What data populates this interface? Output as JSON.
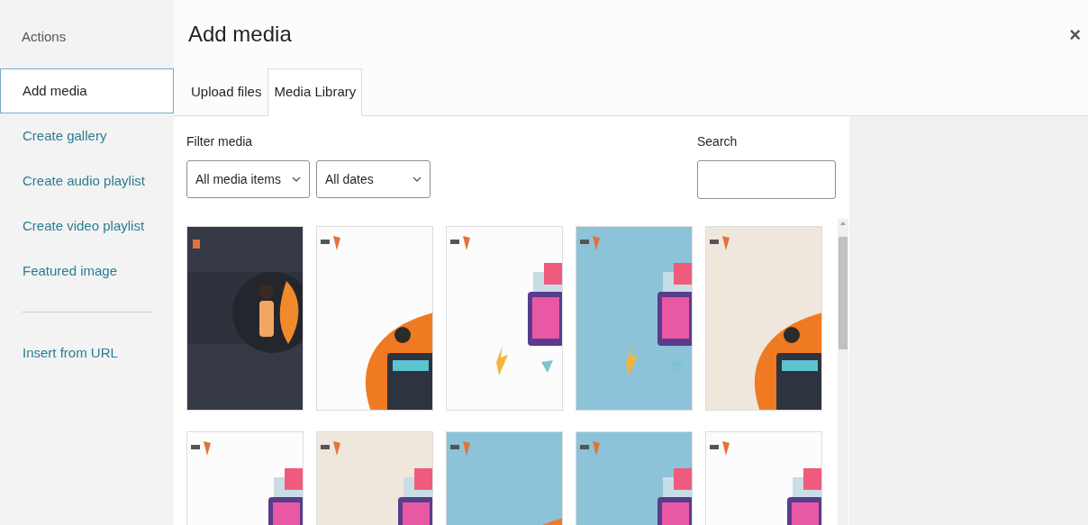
{
  "sidebar": {
    "heading": "Actions",
    "items": [
      {
        "label": "Add media",
        "selected": true
      },
      {
        "label": "Create gallery",
        "selected": false
      },
      {
        "label": "Create audio playlist",
        "selected": false
      },
      {
        "label": "Create video playlist",
        "selected": false
      },
      {
        "label": "Featured image",
        "selected": false
      }
    ],
    "extra_items": [
      {
        "label": "Insert from URL",
        "selected": false
      }
    ]
  },
  "title": "Add media",
  "close": "×",
  "tabs": [
    {
      "label": "Upload files",
      "selected": false
    },
    {
      "label": "Media Library",
      "selected": true
    }
  ],
  "filter": {
    "label": "Filter media",
    "selects": [
      {
        "value": "All media items"
      },
      {
        "value": "All dates"
      }
    ]
  },
  "search": {
    "label": "Search"
  },
  "thumbnails": [
    {
      "kind": "dark"
    },
    {
      "kind": "white"
    },
    {
      "kind": "white"
    },
    {
      "kind": "blue"
    },
    {
      "kind": "beige"
    },
    {
      "kind": "white"
    },
    {
      "kind": "beige"
    },
    {
      "kind": "blue"
    },
    {
      "kind": "blue"
    },
    {
      "kind": "white"
    }
  ]
}
